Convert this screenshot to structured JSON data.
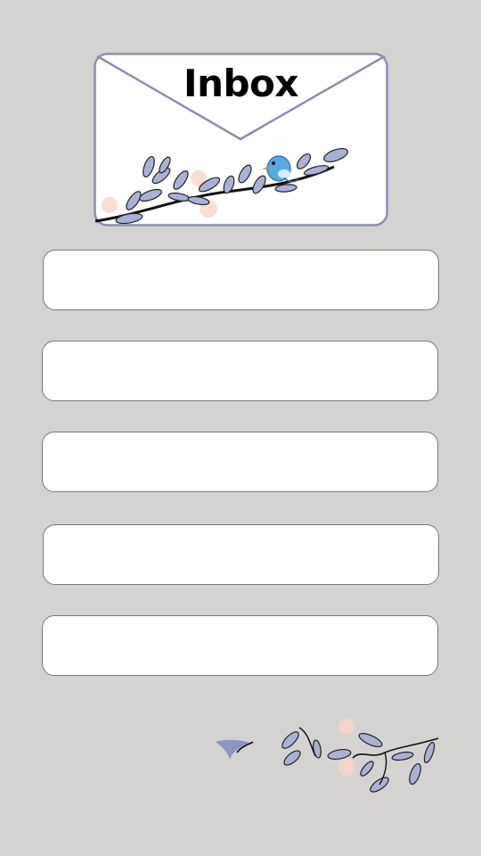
{
  "header": {
    "title": "Inbox",
    "icon": "envelope-icon",
    "decoration": "bird-on-branch-icon"
  },
  "messages": [
    {
      "slot": 1,
      "text": ""
    },
    {
      "slot": 2,
      "text": ""
    },
    {
      "slot": 3,
      "text": ""
    },
    {
      "slot": 4,
      "text": ""
    },
    {
      "slot": 5,
      "text": ""
    }
  ],
  "footer": {
    "decoration": "vine-leaves-icon"
  },
  "colors": {
    "background": "#d4d3d2",
    "envelope_outline": "#8a8fb0",
    "leaf_fill": "#a9b1d4",
    "bird": "#5aa8e0",
    "blossom": "#f2b7a0"
  }
}
